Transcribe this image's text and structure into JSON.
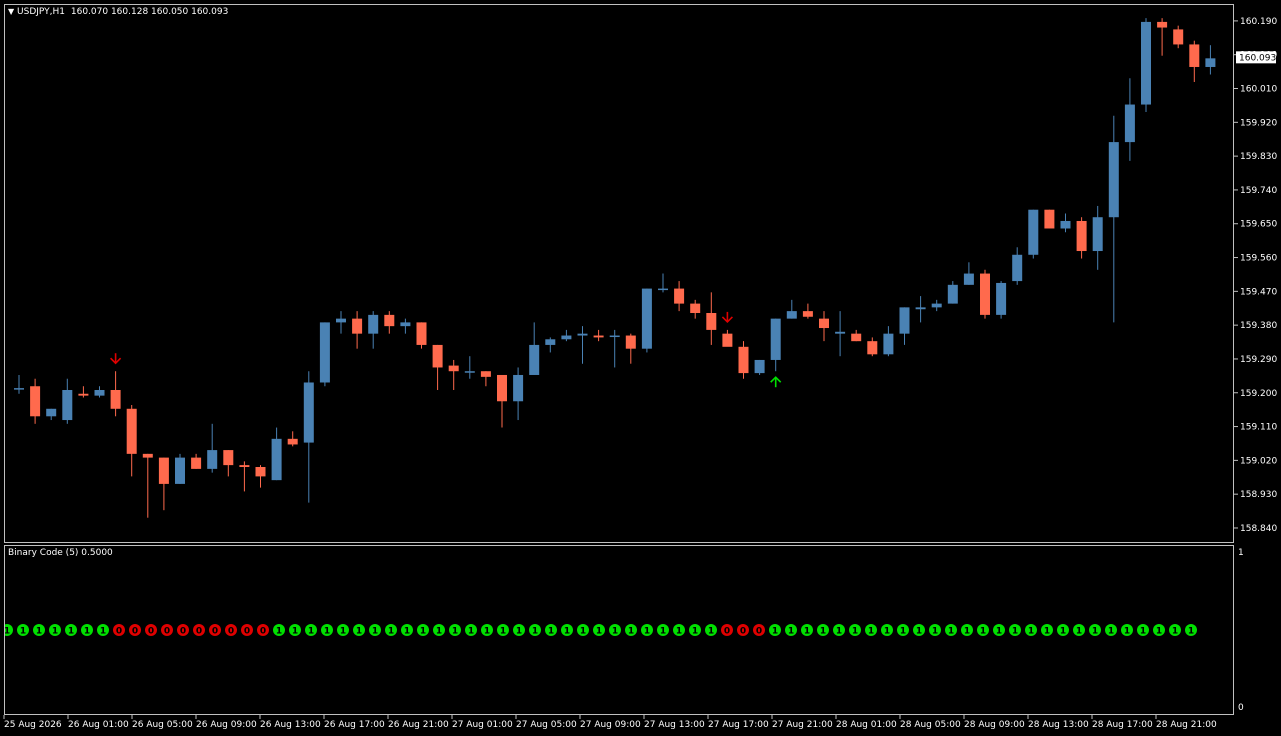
{
  "chart_header": {
    "symbol_period": "USDJPY,H1",
    "ohlc": "160.070 160.128 160.050 160.093"
  },
  "indicator": {
    "title": "Binary Code (5) 0.5000",
    "scale_top": "1",
    "scale_bottom": "0"
  },
  "current_price_label": "160.093",
  "colors": {
    "bull": "#4a82b4",
    "bear": "#ff6a4d",
    "one": "#00e000",
    "zero": "#e00000",
    "up_arrow": "#00e000",
    "down_arrow": "#e00000",
    "background": "#000000",
    "border": "#c0c0c0"
  },
  "chart_data": {
    "type": "candlestick",
    "ylim": [
      158.8,
      160.235
    ],
    "price_ticks": [
      "160.190",
      "160.100",
      "160.010",
      "159.920",
      "159.830",
      "159.740",
      "159.650",
      "159.560",
      "159.470",
      "159.380",
      "159.290",
      "159.200",
      "159.110",
      "159.020",
      "158.930",
      "158.840"
    ],
    "time_labels": [
      "25 Aug 2026",
      "26 Aug 01:00",
      "26 Aug 05:00",
      "26 Aug 09:00",
      "26 Aug 13:00",
      "26 Aug 17:00",
      "26 Aug 21:00",
      "27 Aug 01:00",
      "27 Aug 05:00",
      "27 Aug 09:00",
      "27 Aug 13:00",
      "27 Aug 17:00",
      "27 Aug 21:00",
      "28 Aug 01:00",
      "28 Aug 05:00",
      "28 Aug 09:00",
      "28 Aug 13:00",
      "28 Aug 17:00",
      "28 Aug 21:00"
    ],
    "candles": [
      [
        159.215,
        159.25,
        159.2,
        159.215
      ],
      [
        159.22,
        159.24,
        159.12,
        159.14
      ],
      [
        159.14,
        159.16,
        159.13,
        159.16
      ],
      [
        159.13,
        159.24,
        159.12,
        159.21
      ],
      [
        159.2,
        159.22,
        159.19,
        159.195
      ],
      [
        159.195,
        159.22,
        159.19,
        159.21
      ],
      [
        159.21,
        159.26,
        159.14,
        159.16
      ],
      [
        159.16,
        159.17,
        158.98,
        159.04
      ],
      [
        159.04,
        159.04,
        158.87,
        159.03
      ],
      [
        159.03,
        159.03,
        158.89,
        158.96
      ],
      [
        158.96,
        159.04,
        158.96,
        159.03
      ],
      [
        159.03,
        159.04,
        159.0,
        159.0
      ],
      [
        159.0,
        159.12,
        158.99,
        159.05
      ],
      [
        159.05,
        159.05,
        158.98,
        159.01
      ],
      [
        159.01,
        159.02,
        158.94,
        159.005
      ],
      [
        159.005,
        159.01,
        158.95,
        158.98
      ],
      [
        158.97,
        159.11,
        158.97,
        159.08
      ],
      [
        159.08,
        159.1,
        159.06,
        159.065
      ],
      [
        159.07,
        159.26,
        158.91,
        159.23
      ],
      [
        159.23,
        159.39,
        159.22,
        159.39
      ],
      [
        159.39,
        159.42,
        159.36,
        159.4
      ],
      [
        159.4,
        159.42,
        159.32,
        159.36
      ],
      [
        159.36,
        159.42,
        159.32,
        159.41
      ],
      [
        159.41,
        159.42,
        159.36,
        159.38
      ],
      [
        159.38,
        159.4,
        159.36,
        159.39
      ],
      [
        159.39,
        159.39,
        159.32,
        159.33
      ],
      [
        159.33,
        159.33,
        159.21,
        159.27
      ],
      [
        159.275,
        159.29,
        159.21,
        159.26
      ],
      [
        159.26,
        159.3,
        159.24,
        159.26
      ],
      [
        159.26,
        159.26,
        159.22,
        159.245
      ],
      [
        159.25,
        159.25,
        159.11,
        159.18
      ],
      [
        159.18,
        159.27,
        159.13,
        159.25
      ],
      [
        159.25,
        159.39,
        159.25,
        159.33
      ],
      [
        159.33,
        159.35,
        159.31,
        159.345
      ],
      [
        159.345,
        159.37,
        159.34,
        159.355
      ],
      [
        159.355,
        159.38,
        159.28,
        159.36
      ],
      [
        159.355,
        159.37,
        159.34,
        159.35
      ],
      [
        159.355,
        159.37,
        159.27,
        159.355
      ],
      [
        159.355,
        159.36,
        159.28,
        159.32
      ],
      [
        159.32,
        159.48,
        159.31,
        159.48
      ],
      [
        159.48,
        159.52,
        159.47,
        159.48
      ],
      [
        159.48,
        159.5,
        159.42,
        159.44
      ],
      [
        159.44,
        159.45,
        159.4,
        159.415
      ],
      [
        159.415,
        159.47,
        159.33,
        159.37
      ],
      [
        159.36,
        159.37,
        159.33,
        159.325
      ],
      [
        159.325,
        159.34,
        159.24,
        159.255
      ],
      [
        159.255,
        159.29,
        159.25,
        159.29
      ],
      [
        159.29,
        159.4,
        159.26,
        159.4
      ],
      [
        159.4,
        159.45,
        159.4,
        159.42
      ],
      [
        159.42,
        159.44,
        159.4,
        159.405
      ],
      [
        159.4,
        159.42,
        159.34,
        159.375
      ],
      [
        159.36,
        159.42,
        159.3,
        159.365
      ],
      [
        159.36,
        159.37,
        159.34,
        159.34
      ],
      [
        159.34,
        159.35,
        159.3,
        159.305
      ],
      [
        159.305,
        159.38,
        159.3,
        159.36
      ],
      [
        159.36,
        159.43,
        159.33,
        159.43
      ],
      [
        159.425,
        159.46,
        159.39,
        159.43
      ],
      [
        159.43,
        159.45,
        159.42,
        159.44
      ],
      [
        159.44,
        159.5,
        159.44,
        159.49
      ],
      [
        159.49,
        159.55,
        159.49,
        159.52
      ],
      [
        159.52,
        159.53,
        159.4,
        159.41
      ],
      [
        159.41,
        159.5,
        159.4,
        159.495
      ],
      [
        159.5,
        159.59,
        159.49,
        159.57
      ],
      [
        159.57,
        159.69,
        159.56,
        159.69
      ],
      [
        159.69,
        159.69,
        159.64,
        159.64
      ],
      [
        159.64,
        159.68,
        159.63,
        159.66
      ],
      [
        159.66,
        159.67,
        159.56,
        159.58
      ],
      [
        159.58,
        159.7,
        159.53,
        159.67
      ],
      [
        159.67,
        159.94,
        159.39,
        159.87
      ],
      [
        159.87,
        160.04,
        159.82,
        159.97
      ],
      [
        159.97,
        160.2,
        159.95,
        160.19
      ],
      [
        160.19,
        160.2,
        160.1,
        160.175
      ],
      [
        160.17,
        160.18,
        160.12,
        160.13
      ],
      [
        160.13,
        160.14,
        160.03,
        160.07
      ],
      [
        160.07,
        160.128,
        160.05,
        160.093
      ]
    ],
    "signals": [
      {
        "type": "down",
        "index": 6
      },
      {
        "type": "down",
        "index": 44
      },
      {
        "type": "up",
        "index": 47
      }
    ],
    "binary_values": [
      1,
      1,
      1,
      1,
      1,
      1,
      1,
      0,
      0,
      0,
      0,
      0,
      0,
      0,
      0,
      0,
      0,
      1,
      1,
      1,
      1,
      1,
      1,
      1,
      1,
      1,
      1,
      1,
      1,
      1,
      1,
      1,
      1,
      1,
      1,
      1,
      1,
      1,
      1,
      1,
      1,
      1,
      1,
      1,
      1,
      0,
      0,
      0,
      1,
      1,
      1,
      1,
      1,
      1,
      1,
      1,
      1,
      1,
      1,
      1,
      1,
      1,
      1,
      1,
      1,
      1,
      1,
      1,
      1,
      1,
      1,
      1,
      1,
      1,
      1
    ]
  }
}
